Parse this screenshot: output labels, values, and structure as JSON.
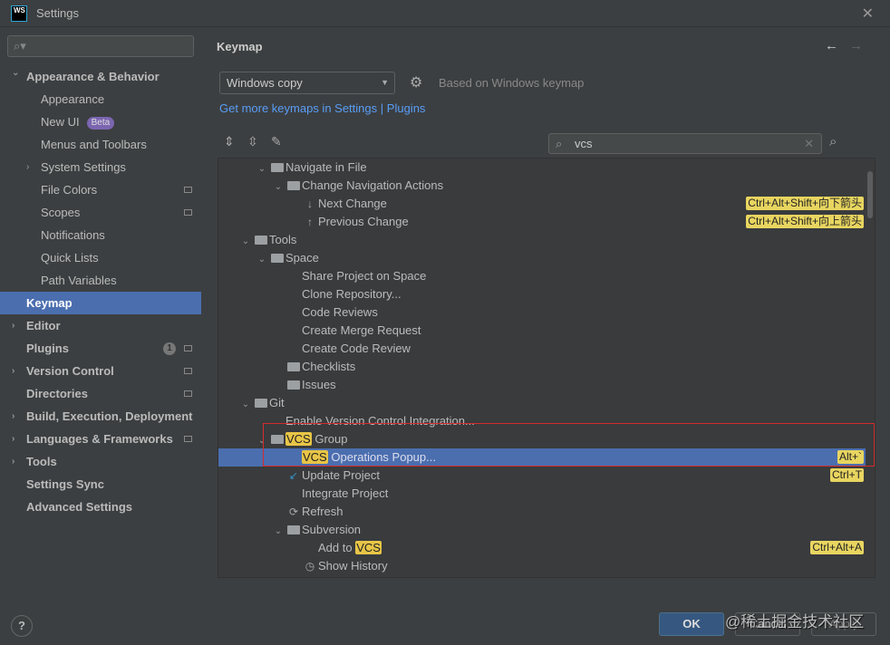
{
  "window": {
    "title": "Settings",
    "logo": "WS"
  },
  "sidebar": {
    "search_placeholder": "",
    "items": [
      {
        "label": "Appearance & Behavior",
        "bold": true,
        "chevron": "open",
        "depth": 0
      },
      {
        "label": "Appearance",
        "depth": 1
      },
      {
        "label": "New UI",
        "depth": 1,
        "badge": "Beta"
      },
      {
        "label": "Menus and Toolbars",
        "depth": 1
      },
      {
        "label": "System Settings",
        "depth": 1,
        "chevron": "closed"
      },
      {
        "label": "File Colors",
        "depth": 1,
        "project": true
      },
      {
        "label": "Scopes",
        "depth": 1,
        "project": true
      },
      {
        "label": "Notifications",
        "depth": 1
      },
      {
        "label": "Quick Lists",
        "depth": 1
      },
      {
        "label": "Path Variables",
        "depth": 1
      },
      {
        "label": "Keymap",
        "bold": true,
        "depth": 0,
        "selected": true
      },
      {
        "label": "Editor",
        "bold": true,
        "depth": 0,
        "chevron": "closed"
      },
      {
        "label": "Plugins",
        "bold": true,
        "depth": 0,
        "count": "1",
        "project": true
      },
      {
        "label": "Version Control",
        "bold": true,
        "depth": 0,
        "chevron": "closed",
        "project": true
      },
      {
        "label": "Directories",
        "bold": true,
        "depth": 0,
        "project": true
      },
      {
        "label": "Build, Execution, Deployment",
        "bold": true,
        "depth": 0,
        "chevron": "closed"
      },
      {
        "label": "Languages & Frameworks",
        "bold": true,
        "depth": 0,
        "chevron": "closed",
        "project": true
      },
      {
        "label": "Tools",
        "bold": true,
        "depth": 0,
        "chevron": "closed"
      },
      {
        "label": "Settings Sync",
        "bold": true,
        "depth": 0
      },
      {
        "label": "Advanced Settings",
        "bold": true,
        "depth": 0
      }
    ]
  },
  "main": {
    "heading": "Keymap",
    "keymap_value": "Windows copy",
    "based_on": "Based on Windows keymap",
    "link_settings": "Get more keymaps in Settings",
    "link_sep": "|",
    "link_plugins": "Plugins",
    "search_value": "vcs"
  },
  "tree": [
    {
      "depth": 1,
      "chevron": "open",
      "icon": "folder",
      "parts": [
        "Navigate in File"
      ]
    },
    {
      "depth": 2,
      "chevron": "open",
      "icon": "folder",
      "parts": [
        "Change Navigation Actions"
      ]
    },
    {
      "depth": 3,
      "icon": "arrow-down",
      "parts": [
        "Next Change"
      ],
      "shortcut": "Ctrl+Alt+Shift+向下箭头"
    },
    {
      "depth": 3,
      "icon": "arrow-up",
      "parts": [
        "Previous Change"
      ],
      "shortcut": "Ctrl+Alt+Shift+向上箭头"
    },
    {
      "depth": 0,
      "chevron": "open",
      "icon": "folder",
      "parts": [
        "Tools"
      ]
    },
    {
      "depth": 1,
      "chevron": "open",
      "icon": "folder",
      "parts": [
        "Space"
      ]
    },
    {
      "depth": 2,
      "parts": [
        "Share Project on Space"
      ]
    },
    {
      "depth": 2,
      "parts": [
        "Clone Repository..."
      ]
    },
    {
      "depth": 2,
      "parts": [
        "Code Reviews"
      ]
    },
    {
      "depth": 2,
      "parts": [
        "Create Merge Request"
      ]
    },
    {
      "depth": 2,
      "parts": [
        "Create Code Review"
      ]
    },
    {
      "depth": 2,
      "icon": "folder",
      "parts": [
        "Checklists"
      ]
    },
    {
      "depth": 2,
      "icon": "folder",
      "parts": [
        "Issues"
      ]
    },
    {
      "depth": 0,
      "chevron": "open",
      "icon": "folder",
      "parts": [
        "Git"
      ]
    },
    {
      "depth": 1,
      "parts": [
        "Enable Version Control Integration..."
      ]
    },
    {
      "depth": 1,
      "chevron": "open",
      "icon": "folder",
      "parts": [
        "",
        "VCS",
        " Group"
      ]
    },
    {
      "depth": 2,
      "parts": [
        "",
        "VCS",
        " Operations Popup..."
      ],
      "shortcut": "Alt+`",
      "selected": true
    },
    {
      "depth": 2,
      "icon": "update",
      "parts": [
        "Update Project"
      ],
      "shortcut": "Ctrl+T"
    },
    {
      "depth": 2,
      "parts": [
        "Integrate Project"
      ]
    },
    {
      "depth": 2,
      "icon": "refresh",
      "parts": [
        "Refresh"
      ]
    },
    {
      "depth": 2,
      "chevron": "open",
      "icon": "folder",
      "parts": [
        "Subversion"
      ]
    },
    {
      "depth": 3,
      "parts": [
        "Add to ",
        "VCS",
        ""
      ],
      "shortcut": "Ctrl+Alt+A"
    },
    {
      "depth": 3,
      "icon": "history",
      "parts": [
        "Show History"
      ]
    }
  ],
  "footer": {
    "help": "?",
    "ok": "OK",
    "cancel": "Cancel",
    "apply": "Apply",
    "watermark": "@稀土掘金技术社区"
  },
  "colors": {
    "selection": "#4b6eaf",
    "highlight": "#e8c547",
    "link": "#589df6",
    "annotation": "#d62c2c"
  }
}
